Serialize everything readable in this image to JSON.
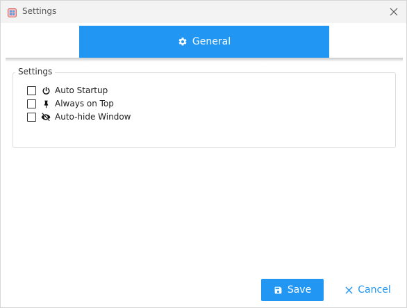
{
  "window": {
    "title": "Settings",
    "accent_color": "#2196f3"
  },
  "tabs": [
    {
      "label": "General",
      "icon": "gear-icon",
      "active": true
    }
  ],
  "group": {
    "title": "Settings",
    "options": [
      {
        "label": "Auto Startup",
        "icon": "power-icon",
        "checked": false
      },
      {
        "label": "Always on Top",
        "icon": "pin-icon",
        "checked": false
      },
      {
        "label": "Auto-hide Window",
        "icon": "eye-slash-icon",
        "checked": false
      }
    ]
  },
  "footer": {
    "save_label": "Save",
    "save_icon": "floppy-disk-icon",
    "cancel_label": "Cancel",
    "cancel_icon": "close-icon"
  }
}
